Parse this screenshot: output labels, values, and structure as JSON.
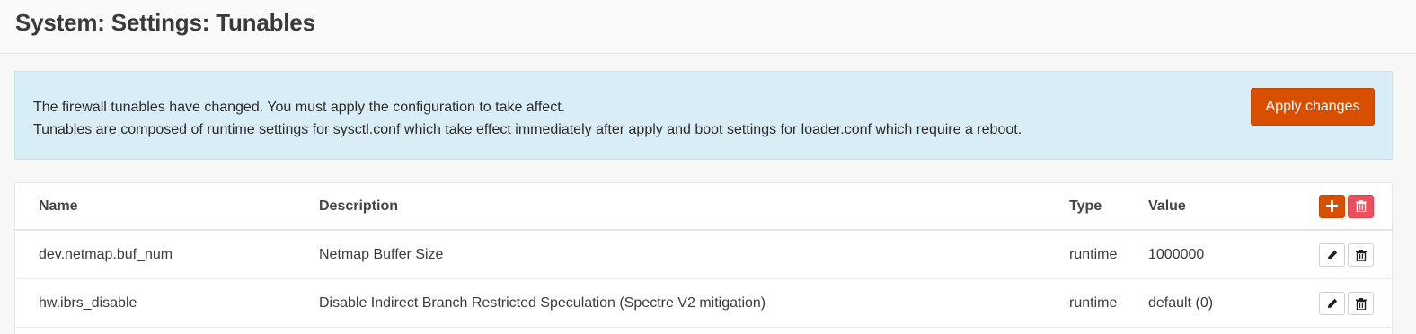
{
  "page": {
    "title": "System: Settings: Tunables"
  },
  "alert": {
    "line1": "The firewall tunables have changed. You must apply the configuration to take affect.",
    "line2": "Tunables are composed of runtime settings for sysctl.conf which take effect immediately after apply and boot settings for loader.conf which require a reboot.",
    "apply_label": "Apply changes"
  },
  "table": {
    "headers": {
      "name": "Name",
      "description": "Description",
      "type": "Type",
      "value": "Value"
    },
    "rows": [
      {
        "name": "dev.netmap.buf_num",
        "description": "Netmap Buffer Size",
        "type": "runtime",
        "value": "1000000"
      },
      {
        "name": "hw.ibrs_disable",
        "description": "Disable Indirect Branch Restricted Speculation (Spectre V2 mitigation)",
        "type": "runtime",
        "value": "default (0)"
      }
    ]
  },
  "icons": {
    "add": "plus-icon",
    "delete_all": "trash-icon",
    "edit": "pencil-icon",
    "delete": "trash-icon"
  },
  "colors": {
    "accent": "#d94f00",
    "danger": "#e8505b",
    "alert_bg": "#d9edf7"
  }
}
